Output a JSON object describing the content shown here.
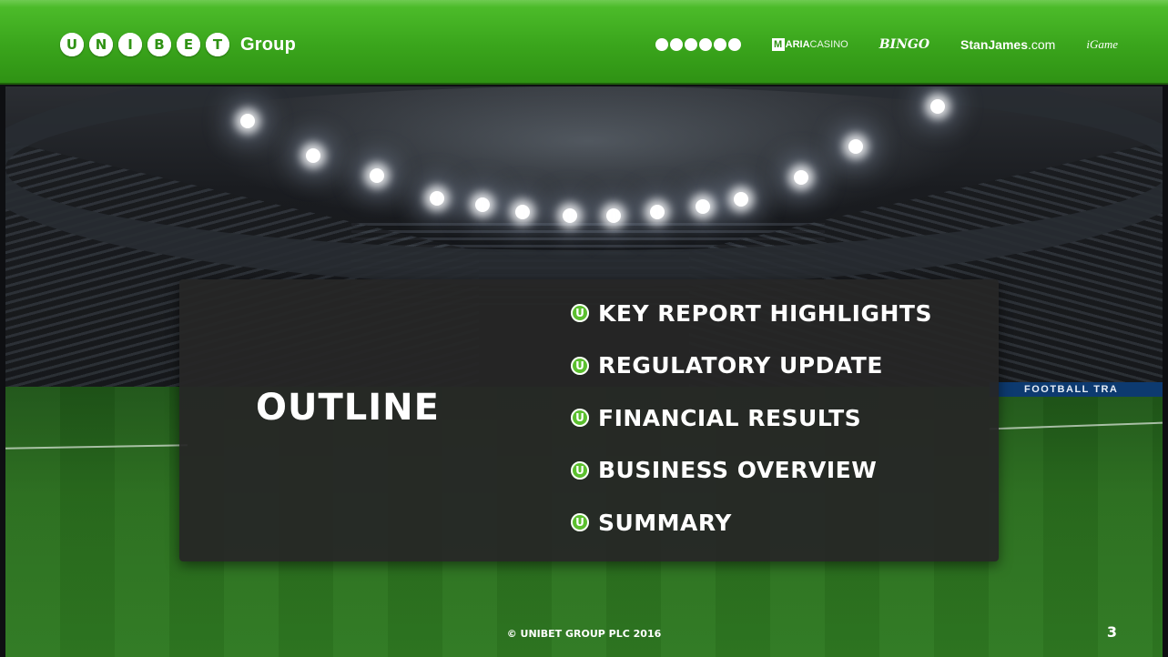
{
  "header": {
    "brand_letters": [
      "U",
      "N",
      "I",
      "B",
      "E",
      "T"
    ],
    "brand_suffix": "Group",
    "partners": {
      "unibet": "UNIBET",
      "maria_box": "M",
      "maria_bold": "ARIA",
      "maria_rest": "CASINO",
      "bingo": "BINGO",
      "stan_bold": "StanJames",
      "stan_rest": ".com",
      "igame": "iGame"
    },
    "colors": {
      "brand_green": "#3aa51c",
      "accent_green": "#5bbf2e"
    }
  },
  "background": {
    "ad_board_text": "FOOTBALL TRA"
  },
  "outline": {
    "title": "OUTLINE",
    "bullet_glyph": "U",
    "items": [
      {
        "label": "KEY REPORT HIGHLIGHTS"
      },
      {
        "label": "REGULATORY UPDATE"
      },
      {
        "label": "FINANCIAL RESULTS"
      },
      {
        "label": "BUSINESS OVERVIEW"
      },
      {
        "label": "SUMMARY"
      }
    ]
  },
  "footer": {
    "copyright": "© UNIBET GROUP PLC 2016",
    "page_number": "3"
  }
}
